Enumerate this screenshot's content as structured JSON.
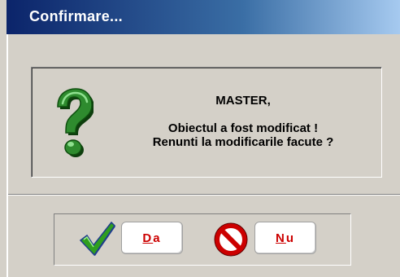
{
  "window": {
    "title": "Confirmare..."
  },
  "message": {
    "heading": "MASTER,",
    "line1": "Obiectul a fost modificat !",
    "line2": "Renunti la modificarile facute ?",
    "icon": "question-icon"
  },
  "buttons": {
    "yes": {
      "mnemonic": "D",
      "rest": "a",
      "icon": "checkmark-icon"
    },
    "no": {
      "mnemonic": "N",
      "rest": "u",
      "icon": "no-entry-icon"
    }
  },
  "colors": {
    "title_bar_start": "#0b246a",
    "title_bar_end": "#a6caf0",
    "dialog_bg": "#d4d0c8",
    "button_text": "#cc0000",
    "question_green": "#2e8b2e",
    "check_green": "#2f9e1f",
    "check_blue": "#1e3c8c",
    "no_entry_red": "#cc0000"
  }
}
